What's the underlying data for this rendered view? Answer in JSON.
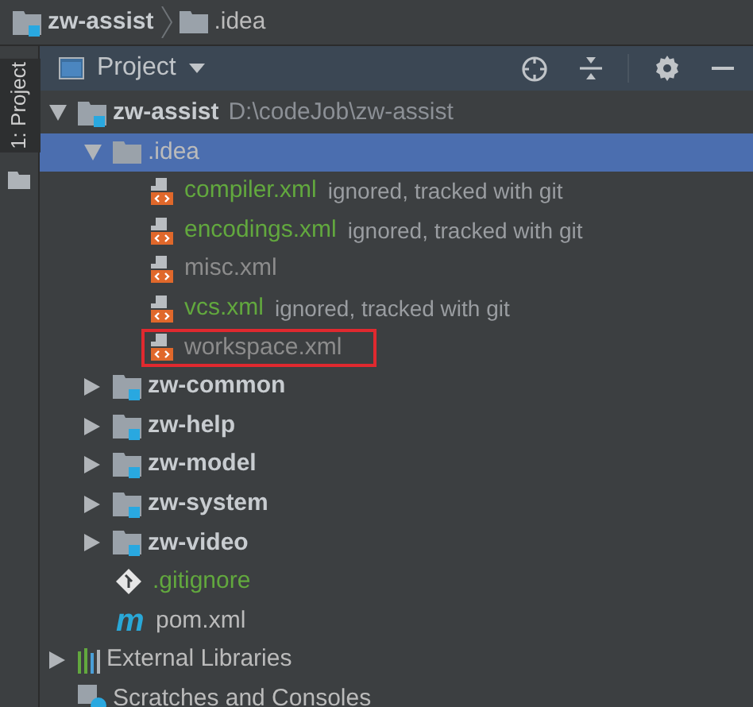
{
  "breadcrumb": [
    {
      "kind": "module",
      "label": "zw-assist"
    },
    {
      "kind": "folder",
      "label": ".idea"
    }
  ],
  "tool_strip": {
    "label": "1: Project",
    "selected": true
  },
  "panel": {
    "title": "Project"
  },
  "tree": [
    {
      "kind": "module",
      "label": "zw-assist",
      "path": "D:\\codeJob\\zw-assist",
      "expanded": true,
      "selected": false,
      "children": [
        {
          "kind": "folder",
          "label": ".idea",
          "expanded": true,
          "selected": true,
          "children": [
            {
              "kind": "xml",
              "label": "compiler.xml",
              "note": "ignored, tracked with git",
              "color": "#62a83e",
              "selected": false,
              "highlighted": false
            },
            {
              "kind": "xml",
              "label": "encodings.xml",
              "note": "ignored, tracked with git",
              "color": "#62a83e",
              "selected": false,
              "highlighted": false
            },
            {
              "kind": "xml",
              "label": "misc.xml",
              "color": "#8c8c8c",
              "selected": false,
              "highlighted": false
            },
            {
              "kind": "xml",
              "label": "vcs.xml",
              "note": "ignored, tracked with git",
              "color": "#62a83e",
              "selected": false,
              "highlighted": false
            },
            {
              "kind": "xml",
              "label": "workspace.xml",
              "color": "#8c8c8c",
              "selected": false,
              "highlighted": true
            }
          ]
        },
        {
          "kind": "module",
          "label": "zw-common",
          "expanded": false,
          "selected": false
        },
        {
          "kind": "module",
          "label": "zw-help",
          "expanded": false,
          "selected": false
        },
        {
          "kind": "module",
          "label": "zw-model",
          "expanded": false,
          "selected": false
        },
        {
          "kind": "module",
          "label": "zw-system",
          "expanded": false,
          "selected": false
        },
        {
          "kind": "module",
          "label": "zw-video",
          "expanded": false,
          "selected": false
        },
        {
          "kind": "git",
          "label": ".gitignore",
          "color": "#62a83e",
          "selected": false,
          "highlighted": false
        },
        {
          "kind": "maven",
          "icon_text": "m",
          "label": "pom.xml",
          "color": "#bbbbbb",
          "selected": false,
          "highlighted": false
        }
      ]
    },
    {
      "kind": "libraries",
      "label": "External Libraries",
      "expanded": false,
      "selected": false
    },
    {
      "kind": "scratches",
      "label": "Scratches and Consoles",
      "selected": false
    }
  ]
}
